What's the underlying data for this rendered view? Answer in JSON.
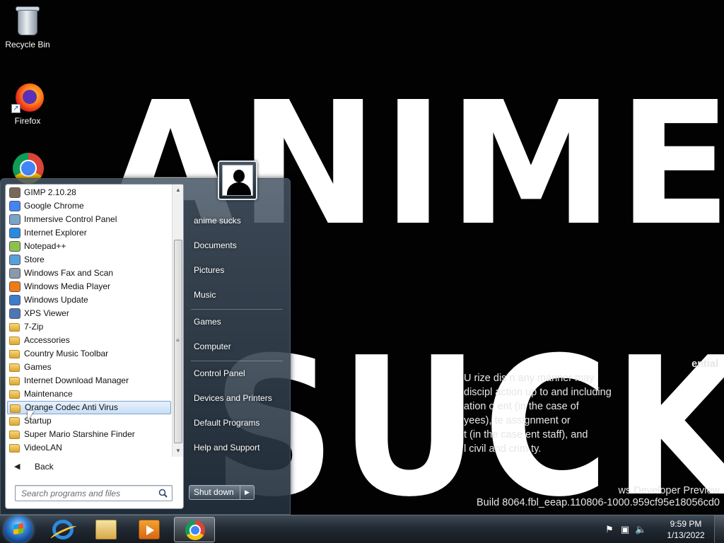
{
  "desktop": {
    "wallpaper_text": [
      "ANIME",
      "SUCKS"
    ],
    "icons": [
      {
        "label": "Recycle Bin",
        "icon": "recycle-bin-icon"
      },
      {
        "label": "Firefox",
        "icon": "firefox-icon"
      },
      {
        "label": "",
        "icon": "chrome-icon"
      }
    ],
    "watermark": {
      "title": "ential",
      "lines": [
        "U  rize   dis   n any manner may",
        "  discipl  action up to and including",
        "  ation o  ent (in the case of",
        "  yees), te   assignment or",
        "  t (in the case  ent staff), and",
        "  l civil and crim   ty."
      ],
      "build_line1": "ws Developer Preview",
      "build_line2": "Build 8064.fbl_eeap.110806-1000.959cf95e18056cd0"
    }
  },
  "start_menu": {
    "programs": [
      {
        "label": "GIMP 2.10.28",
        "type": "app",
        "icon": "gimp-icon",
        "color": "#7a6a55"
      },
      {
        "label": "Google Chrome",
        "type": "app",
        "icon": "chrome-icon",
        "color": "#4285f4"
      },
      {
        "label": "Immersive Control Panel",
        "type": "app",
        "icon": "control-panel-icon",
        "color": "#7aa5c9"
      },
      {
        "label": "Internet Explorer",
        "type": "app",
        "icon": "internet-explorer-icon",
        "color": "#2b8ae0"
      },
      {
        "label": "Notepad++",
        "type": "app",
        "icon": "notepad-plus-plus-icon",
        "color": "#8bc34a"
      },
      {
        "label": "Store",
        "type": "app",
        "icon": "store-icon",
        "color": "#5aa0d8"
      },
      {
        "label": "Windows Fax and Scan",
        "type": "app",
        "icon": "fax-scan-icon",
        "color": "#8a9aa8"
      },
      {
        "label": "Windows Media Player",
        "type": "app",
        "icon": "media-player-icon",
        "color": "#f07b12"
      },
      {
        "label": "Windows Update",
        "type": "app",
        "icon": "windows-update-icon",
        "color": "#3a7dc9"
      },
      {
        "label": "XPS Viewer",
        "type": "app",
        "icon": "xps-viewer-icon",
        "color": "#4a78b5"
      },
      {
        "label": "7-Zip",
        "type": "folder",
        "icon": "folder-icon"
      },
      {
        "label": "Accessories",
        "type": "folder",
        "icon": "folder-icon"
      },
      {
        "label": "Country Music Toolbar",
        "type": "folder",
        "icon": "folder-icon"
      },
      {
        "label": "Games",
        "type": "folder",
        "icon": "folder-icon"
      },
      {
        "label": "Internet Download Manager",
        "type": "folder",
        "icon": "folder-icon"
      },
      {
        "label": "Maintenance",
        "type": "folder",
        "icon": "folder-icon"
      },
      {
        "label": "Orange Codec Anti Virus",
        "type": "folder",
        "icon": "folder-icon",
        "selected": true
      },
      {
        "label": "Startup",
        "type": "folder",
        "icon": "folder-icon"
      },
      {
        "label": "Super Mario Starshine Finder",
        "type": "folder",
        "icon": "folder-icon"
      },
      {
        "label": "VideoLAN",
        "type": "folder",
        "icon": "folder-icon"
      }
    ],
    "back_label": "Back",
    "search_placeholder": "Search programs and files",
    "right_items": [
      "anime sucks",
      "Documents",
      "Pictures",
      "Music",
      "Games",
      "Computer",
      "Control Panel",
      "Devices and Printers",
      "Default Programs",
      "Help and Support"
    ],
    "shutdown_label": "Shut down"
  },
  "taskbar": {
    "pinned": [
      {
        "name": "internet-explorer",
        "icon": "internet-explorer-icon"
      },
      {
        "name": "windows-explorer",
        "icon": "folder-library-icon"
      },
      {
        "name": "media-player",
        "icon": "media-player-icon"
      },
      {
        "name": "chrome",
        "icon": "chrome-icon",
        "active": true
      }
    ],
    "clock": {
      "time": "9:59 PM",
      "date": "1/13/2022"
    }
  }
}
